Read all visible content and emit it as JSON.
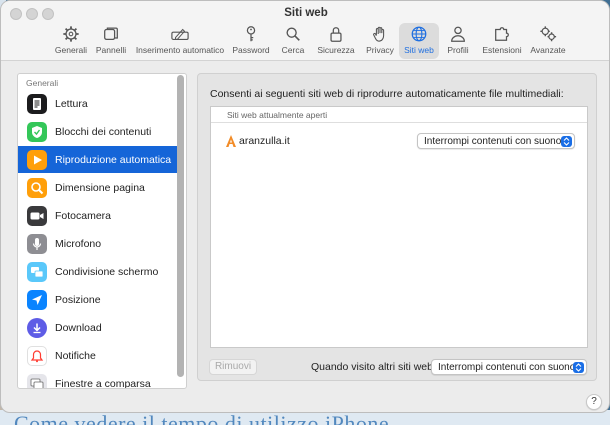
{
  "window": {
    "title": "Siti web"
  },
  "tabs": [
    {
      "label": "Generali",
      "icon": "gear-icon"
    },
    {
      "label": "Pannelli",
      "icon": "tabs-icon"
    },
    {
      "label": "Inserimento automatico",
      "icon": "autofill-icon"
    },
    {
      "label": "Password",
      "icon": "key-icon"
    },
    {
      "label": "Cerca",
      "icon": "search-icon"
    },
    {
      "label": "Sicurezza",
      "icon": "lock-icon"
    },
    {
      "label": "Privacy",
      "icon": "hand-icon"
    },
    {
      "label": "Siti web",
      "icon": "globe-icon",
      "active": true
    },
    {
      "label": "Profili",
      "icon": "person-icon"
    },
    {
      "label": "Estensioni",
      "icon": "puzzle-icon"
    },
    {
      "label": "Avanzate",
      "icon": "gears-icon"
    }
  ],
  "sidebar": {
    "header": "Generali",
    "items": [
      {
        "label": "Lettura",
        "icon": "reader-icon",
        "color": "#1c1c1e"
      },
      {
        "label": "Blocchi dei contenuti",
        "icon": "shield-check-icon",
        "color": "#34c759"
      },
      {
        "label": "Riproduzione automatica",
        "icon": "play-icon",
        "color": "#ff9f0a",
        "active": true
      },
      {
        "label": "Dimensione pagina",
        "icon": "magnifier-icon",
        "color": "#ff9f0a"
      },
      {
        "label": "Fotocamera",
        "icon": "camera-icon",
        "color": "#3a3a3c"
      },
      {
        "label": "Microfono",
        "icon": "microphone-icon",
        "color": "#8e8e93"
      },
      {
        "label": "Condivisione schermo",
        "icon": "screens-icon",
        "color": "#5ac8fa"
      },
      {
        "label": "Posizione",
        "icon": "location-arrow-icon",
        "color": "#0a84ff"
      },
      {
        "label": "Download",
        "icon": "download-icon",
        "color": "#5e5ce6"
      },
      {
        "label": "Notifiche",
        "icon": "bell-icon",
        "color": "#ffffff"
      },
      {
        "label": "Finestre a comparsa",
        "icon": "popup-window-icon",
        "color": "#e5e5ea"
      }
    ]
  },
  "main": {
    "description": "Consenti ai seguenti siti web di riprodurre automaticamente file multimediali:",
    "list_header": "Siti web attualmente aperti",
    "sites": [
      {
        "name": "aranzulla.it",
        "setting": "Interrompi contenuti con suono"
      }
    ],
    "remove_button": "Rimuovi",
    "other_sites_label": "Quando visito altri siti web:",
    "other_sites_setting": "Interrompi contenuti con suono"
  },
  "help_button": "?",
  "background_text": "Come vedere il tempo di utilizzo iPhone"
}
